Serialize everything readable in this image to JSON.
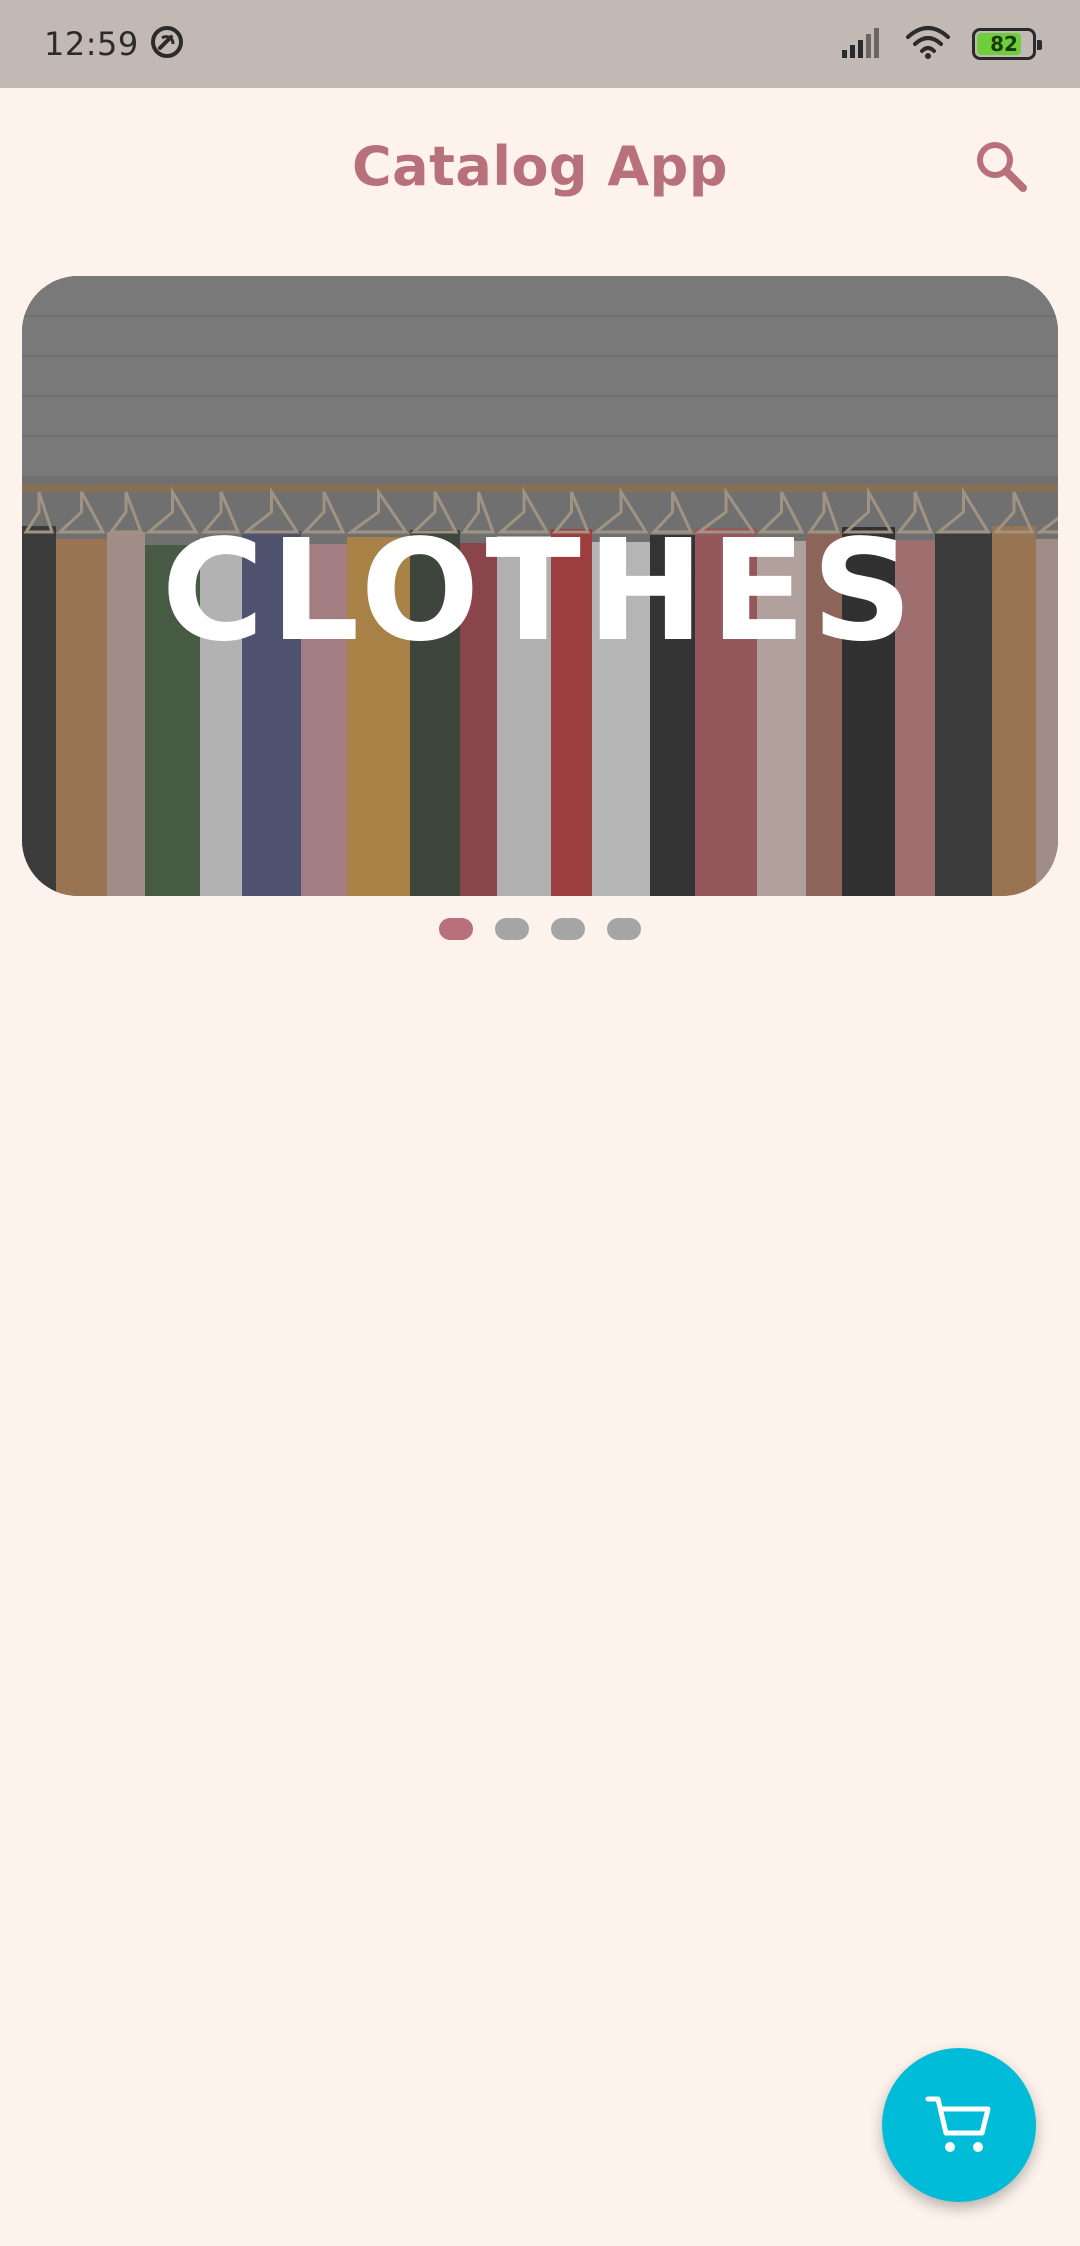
{
  "status_bar": {
    "time": "12:59",
    "battery_level": "82"
  },
  "app_bar": {
    "title": "Catalog App"
  },
  "carousel": {
    "slides": [
      {
        "label": "CLOTHES"
      }
    ],
    "active_index": 0,
    "dot_count": 4
  },
  "colors": {
    "background": "#fdf3ec",
    "accent": "#b8717a",
    "fab": "#00bcd8",
    "dot_inactive": "#a5a5a5",
    "status_bar": "#c2b8b4"
  },
  "icons": {
    "search": "search-icon",
    "cart": "cart-icon",
    "sync": "sync-status-icon"
  }
}
